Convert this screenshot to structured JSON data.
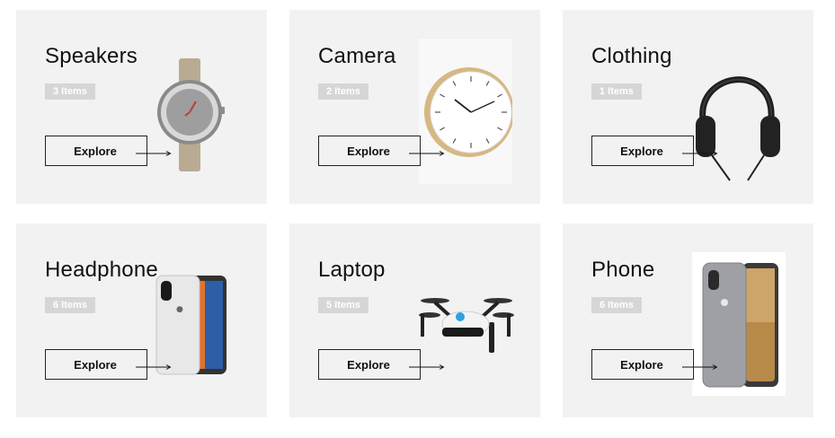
{
  "categories": [
    {
      "title": "Speakers",
      "count": "3 Items",
      "button": "Explore",
      "image": "smartwatch"
    },
    {
      "title": "Camera",
      "count": "2 Items",
      "button": "Explore",
      "image": "wall-clock"
    },
    {
      "title": "Clothing",
      "count": "1 Items",
      "button": "Explore",
      "image": "headphones"
    },
    {
      "title": "Headphone",
      "count": "6 Items",
      "button": "Explore",
      "image": "smartphone-silver"
    },
    {
      "title": "Laptop",
      "count": "5 Items",
      "button": "Explore",
      "image": "drone"
    },
    {
      "title": "Phone",
      "count": "6 Items",
      "button": "Explore",
      "image": "smartphone-clear-case"
    }
  ],
  "colors": {
    "card_background": "#f2f2f2",
    "badge_background": "#d6d6d6",
    "badge_text": "#ffffff",
    "text": "#111111"
  }
}
